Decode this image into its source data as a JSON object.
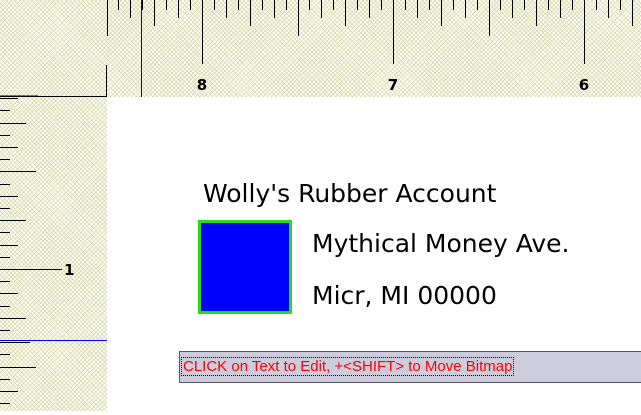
{
  "ruler": {
    "top_labels": [
      "8",
      "7",
      "6"
    ],
    "left_labels": [
      "1"
    ]
  },
  "check": {
    "account_name": "Wolly's Rubber Account",
    "address_line1": "Mythical Money Ave.",
    "address_line2": "Micr, MI 00000"
  },
  "bitmap": {
    "fill_color": "#0000ff",
    "border_color": "#22dd22"
  },
  "status": {
    "hint": "CLICK on Text to Edit, +<SHIFT> to Move Bitmap"
  },
  "colors": {
    "ruler_background": "#fffff0",
    "cursor_guide": "#0000ff",
    "hint_text": "#ff0000"
  }
}
